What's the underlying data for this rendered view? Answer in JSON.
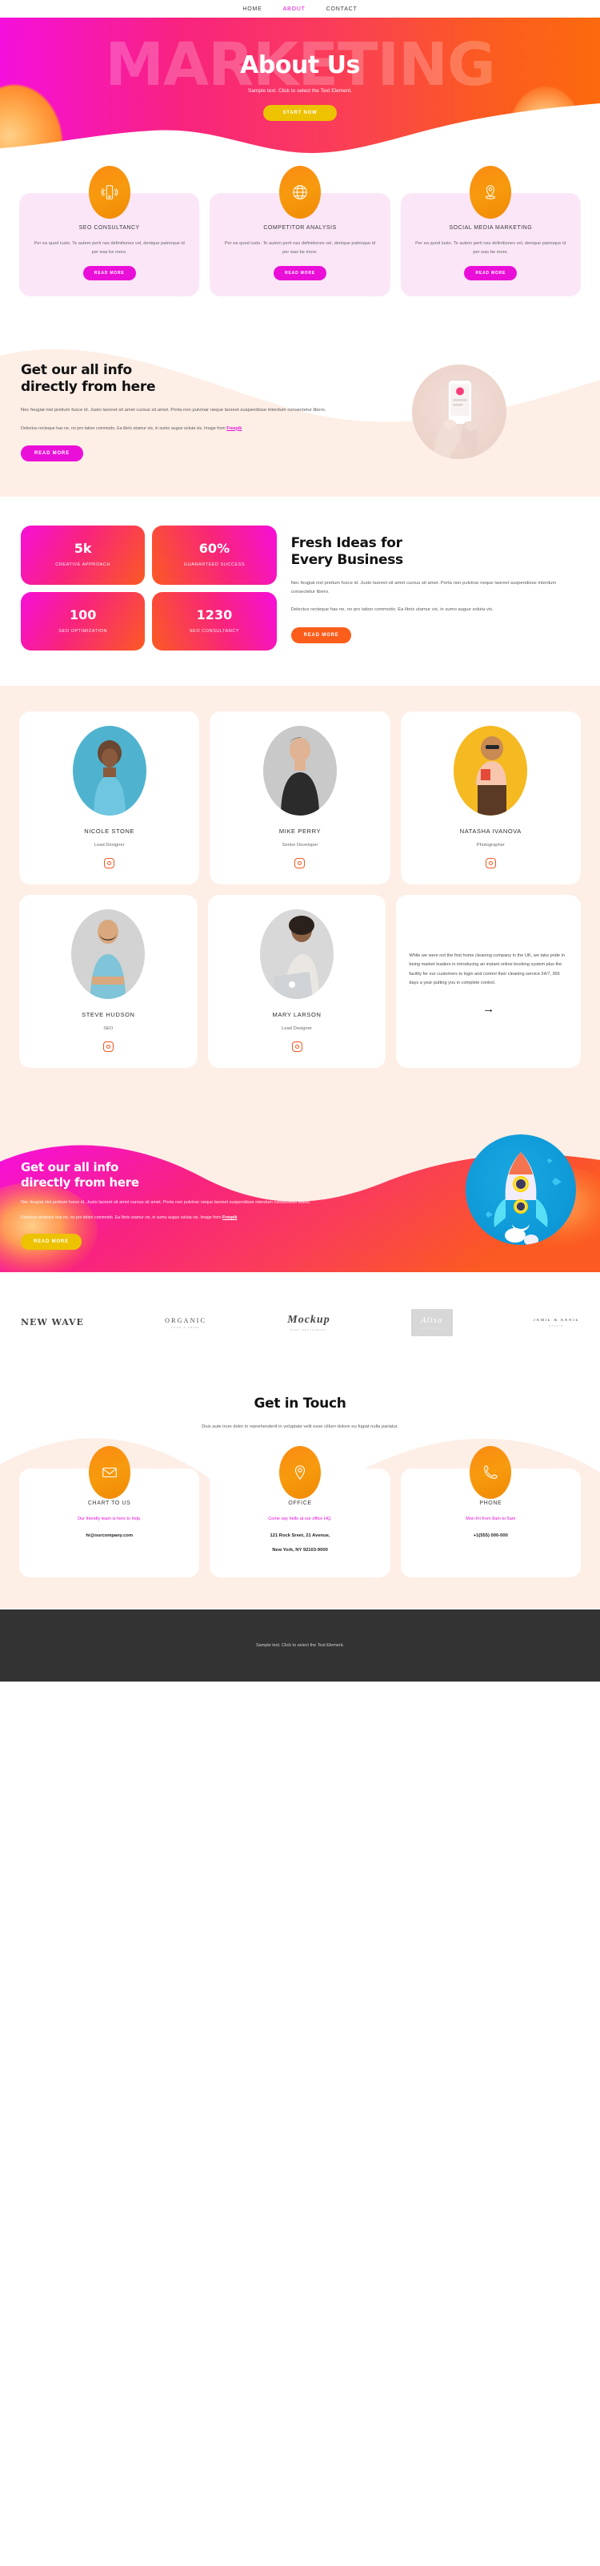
{
  "nav": {
    "items": [
      {
        "label": "HOME",
        "active": false
      },
      {
        "label": "ABOUT",
        "active": true
      },
      {
        "label": "CONTACT",
        "active": false
      }
    ]
  },
  "hero": {
    "ghost_text": "MARKETING",
    "title": "About Us",
    "subtitle": "Sample text. Click to select the Text Element.",
    "cta_label": "START NOW"
  },
  "services": {
    "cards": [
      {
        "icon": "mobile-signal-icon",
        "title": "SEO CONSULTANCY",
        "body": "Per ea quod iusto. Te autem perti nax definitiones vel, denique patrioque id per was be more.",
        "button": "READ MORE"
      },
      {
        "icon": "globe-icon",
        "title": "COMPETITOR ANALYSIS",
        "body": "Per ea quod iusto. Te autem perti nax definitiones vel, denique patrioque id per was be more.",
        "button": "READ MORE"
      },
      {
        "icon": "map-pin-icon",
        "title": "SOCIAL MEDIA MARKETING",
        "body": "Per ea quod iusto. Te autem perti nax definitiones vel, denique patrioque id per was be more.",
        "button": "READ MORE"
      }
    ]
  },
  "info": {
    "heading_line1": "Get our all info",
    "heading_line2": "directly from here",
    "paragraph1": "Nec feugiat nisl pretium fusce id. Justo laoreet sit amet cursus sit amet. Porta non pulvinar neque laoreet suspendisse interdum consectetur libero.",
    "paragraph2_pre": "Delectus recteque has ne, no pro tation commodo. Ea libris utamur vix, in sumo augue soluta vis. Image from ",
    "paragraph2_link": "Freepik",
    "button": "READ MORE",
    "image_alt": "hand-holding-phone-illustration"
  },
  "stats": {
    "items": [
      {
        "number": "5k",
        "label": "CREATIVE APPROACH"
      },
      {
        "number": "60%",
        "label": "GUARANTEED SUCCESS"
      },
      {
        "number": "100",
        "label": "SEO OPTIMIZATION"
      },
      {
        "number": "1230",
        "label": "SEO CONSULTANCY"
      }
    ],
    "heading_line1": "Fresh Ideas for",
    "heading_line2": "Every Business",
    "paragraph1": "Nec feugiat nisl pretium fusce id. Justo laoreet sit amet cursus sit amet. Porta non pulvinar neque laoreet suspendisse interdum consectetur libero.",
    "paragraph2": "Delectus recteque has ne, no pro tation commodo. Ea libris utamur vix, in sumo augue soluta vis.",
    "button": "READ MORE"
  },
  "team": {
    "row1": [
      {
        "name": "NICOLE STONE",
        "role": "Lead Designer",
        "bg": "#4fb3cf"
      },
      {
        "name": "MIKE PERRY",
        "role": "Senior Developer",
        "bg": "#c9c9c9"
      },
      {
        "name": "NATASHA IVANOVA",
        "role": "Photographer",
        "bg": "#f5b921"
      }
    ],
    "row2": [
      {
        "name": "STEVE HUDSON",
        "role": "SEO",
        "bg": "#d3d3d3"
      },
      {
        "name": "MARY LARSON",
        "role": "Lead Designer",
        "bg": "#d8d8d8"
      }
    ],
    "quote": "While we were not the first home cleaning company in the UK, we take pride in being market leaders in introducing an instant online booking system plus the facility for our customers to login and control their cleaning service 24/7, 365 days a year putting you in complete control.",
    "arrow": "→"
  },
  "cta": {
    "heading_line1": "Get our all info",
    "heading_line2": "directly from here",
    "paragraph1": "Nec feugiat nisl pretium fusce id. Justo laoreet sit amet cursus sit amet. Porta non pulvinar neque laoreet suspendisse interdum consectetur libero.",
    "paragraph2_pre": "Delectus recteque has ne, no pro tation commodo. Ea libris utamur vix, in sumo augue soluta vis. Image from ",
    "paragraph2_link": "Freepik",
    "button": "READ MORE",
    "image_alt": "rocket-illustration"
  },
  "logos": [
    {
      "main": "NEW WAVE",
      "sub": ""
    },
    {
      "main": "ORGANIC",
      "sub": "FOOD & DRINK"
    },
    {
      "main": "Mockup",
      "sub": "BARS RESTAURANT"
    },
    {
      "main": "Alisa",
      "sub": "BOUTIQUE"
    },
    {
      "main": "JAMIE & ANNIE",
      "sub": "STUDIO"
    }
  ],
  "contact": {
    "title": "Get in Touch",
    "subtitle": "Duis aute irure dolor in reprehenderit in voluptate velit esse cillum dolore eu fugiat nulla pariatur.",
    "cards": [
      {
        "icon": "envelope-icon",
        "title": "CHART TO US",
        "sub": "Our friendly team is here to help.",
        "value": "hi@ourcompany.com",
        "value2": ""
      },
      {
        "icon": "map-pin-icon",
        "title": "OFFICE",
        "sub": "Come say hello at our office HQ.",
        "value": "121 Rock Sreet, 21 Avenue,",
        "value2": "New York, NY 92103-9000"
      },
      {
        "icon": "phone-icon",
        "title": "PHONE",
        "sub": "Mon-Fri from 8am to 5am",
        "value": "+1(555) 000-000",
        "value2": ""
      }
    ]
  },
  "footer": {
    "text": "Sample text. Click to select the Text Element."
  },
  "colors": {
    "magenta": "#e612d8",
    "orange": "#fb5d1b",
    "yellow": "#edc200",
    "pink_bg": "#fbe6f7",
    "peach_bg": "#fdeee6",
    "footer_bg": "#333333"
  }
}
